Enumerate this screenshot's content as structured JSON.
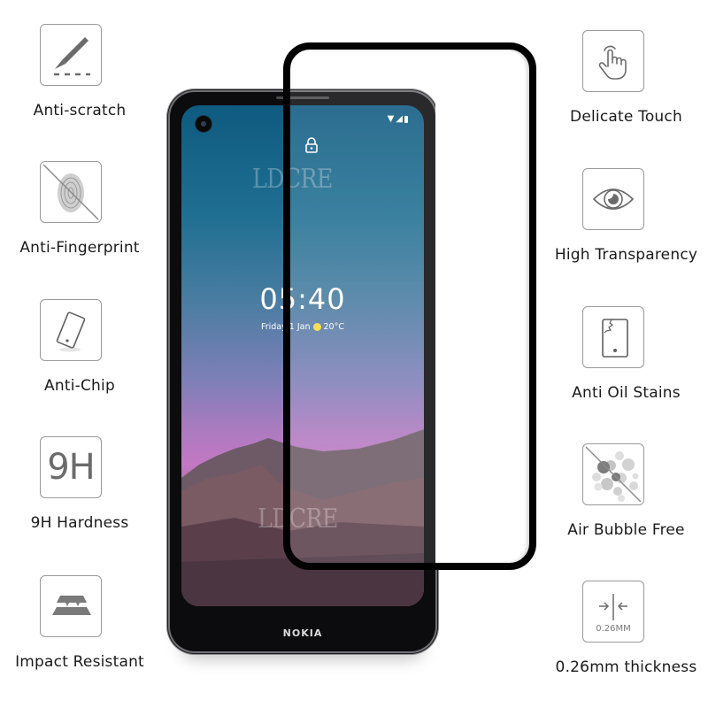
{
  "features_left": [
    {
      "label": "Anti-scratch",
      "icon": "scalpel-icon"
    },
    {
      "label": "Anti-Fingerprint",
      "icon": "fingerprint-crossed-icon"
    },
    {
      "label": "Anti-Chip",
      "icon": "tilted-phone-icon"
    },
    {
      "label": "9H Hardness",
      "icon": "9h-icon",
      "icon_text": "9H"
    },
    {
      "label": "Impact Resistant",
      "icon": "layers-icon"
    }
  ],
  "features_right": [
    {
      "label": "Delicate Touch",
      "icon": "hand-touch-icon"
    },
    {
      "label": "High Transparency",
      "icon": "eye-icon"
    },
    {
      "label": "Anti Oil Stains",
      "icon": "cracked-phone-icon"
    },
    {
      "label": "Air Bubble Free",
      "icon": "bubbles-crossed-icon"
    },
    {
      "label": "0.26mm thickness",
      "icon": "thickness-icon",
      "icon_text": "0.26MM"
    }
  ],
  "phone": {
    "brand": "NOKIA",
    "clock": "05:40",
    "date": "Friday 1 Jan",
    "temperature": "20°C",
    "watermark": "LDCRE",
    "colors": {
      "screen_top": "#0f5a80",
      "screen_mid": "#7f7fb8",
      "screen_pink": "#c478c4",
      "frame": "#0c0c0e",
      "film_border": "#000000"
    }
  }
}
